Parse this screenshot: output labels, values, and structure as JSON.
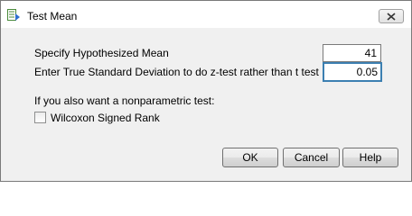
{
  "window": {
    "title": "Test Mean"
  },
  "form": {
    "mean_label": "Specify Hypothesized Mean",
    "mean_value": "41",
    "sd_label": "Enter True Standard Deviation to do z-test rather than t test",
    "sd_value": "0.05",
    "nonparam_label": "If you also want a nonparametric test:",
    "wilcoxon_label": "Wilcoxon Signed Rank",
    "wilcoxon_checked": false
  },
  "buttons": {
    "ok": "OK",
    "cancel": "Cancel",
    "help": "Help"
  },
  "icons": {
    "app": "test-mean-app-icon",
    "close": "close-icon"
  },
  "colors": {
    "focus_border": "#3c7fb1",
    "dialog_bg": "#f0f0f0"
  }
}
